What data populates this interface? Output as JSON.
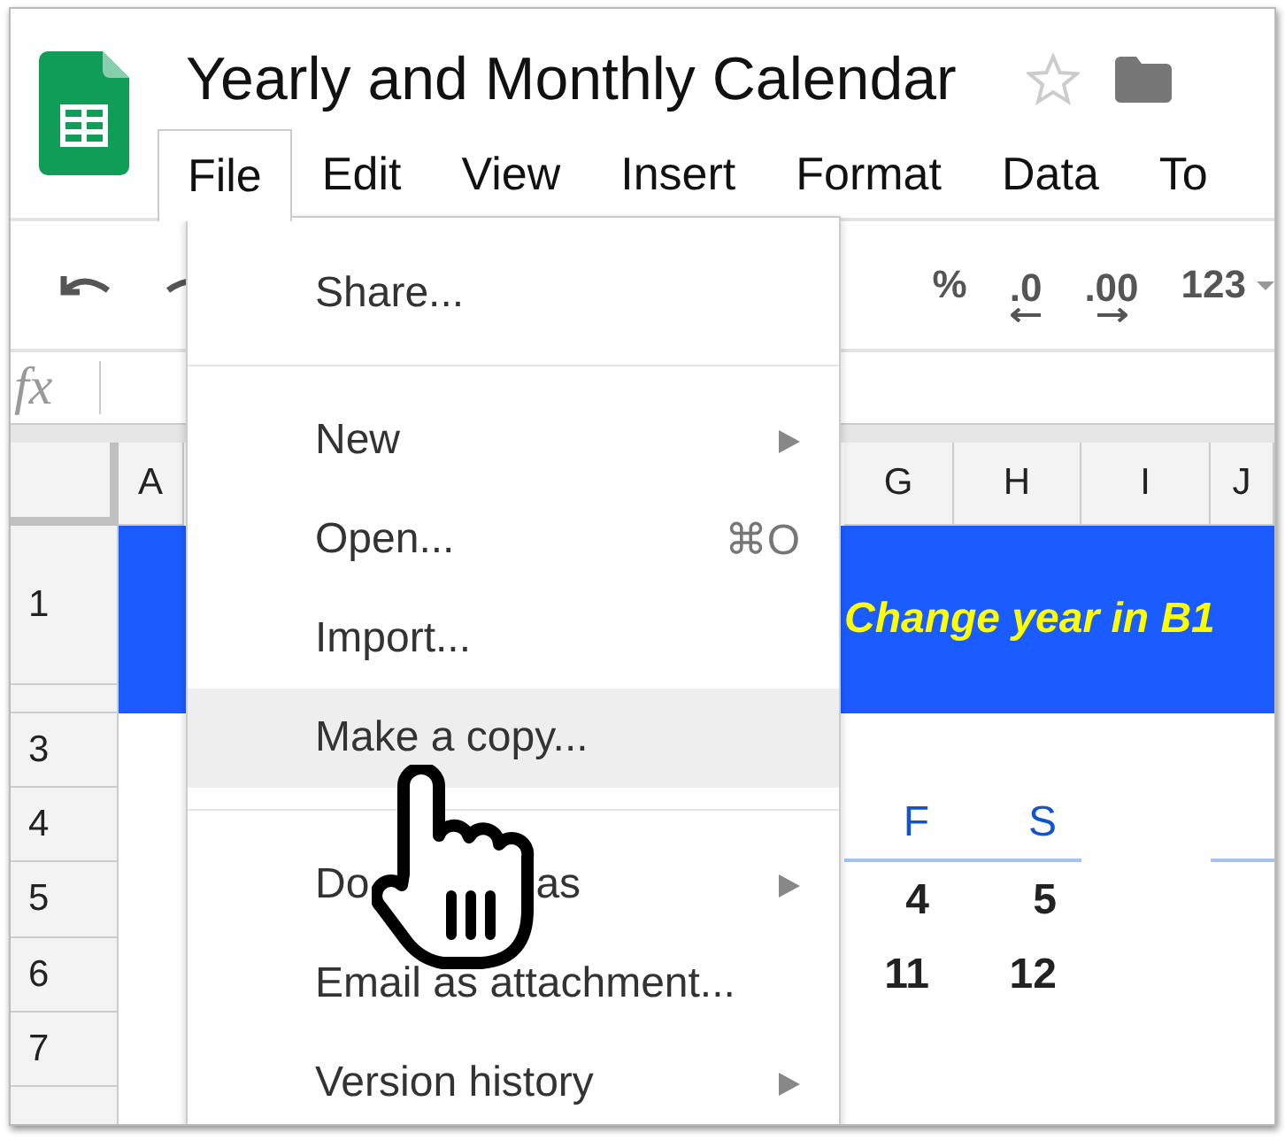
{
  "document": {
    "title": "Yearly and Monthly Calendar",
    "starred": false
  },
  "menu_bar": [
    {
      "label": "File",
      "selected": true
    },
    {
      "label": "Edit",
      "selected": false
    },
    {
      "label": "View",
      "selected": false
    },
    {
      "label": "Insert",
      "selected": false
    },
    {
      "label": "Format",
      "selected": false
    },
    {
      "label": "Data",
      "selected": false
    },
    {
      "label": "To",
      "selected": false
    }
  ],
  "toolbar": {
    "percent": "%",
    "decrease_decimals": ".0",
    "increase_decimals": ".00",
    "number_format": "123"
  },
  "formula_bar": {
    "label": "fx"
  },
  "sheet": {
    "columns": [
      "A",
      "G",
      "H",
      "I",
      "J"
    ],
    "row_numbers": [
      "1",
      "3",
      "4",
      "5",
      "6",
      "7"
    ],
    "banner": "Change year in B1",
    "calendar": {
      "headers": [
        "F",
        "S"
      ],
      "weeks": [
        [
          "4",
          "5"
        ],
        [
          "11",
          "12"
        ]
      ]
    }
  },
  "file_menu": [
    {
      "kind": "item",
      "label": "Share...",
      "selected": false
    },
    {
      "kind": "divider"
    },
    {
      "kind": "submenu",
      "label": "New",
      "selected": false
    },
    {
      "kind": "item",
      "label": "Open...",
      "shortcut": "⌘O",
      "selected": false
    },
    {
      "kind": "item",
      "label": "Import...",
      "selected": false
    },
    {
      "kind": "item",
      "label": "Make a copy...",
      "selected": true
    },
    {
      "kind": "divider"
    },
    {
      "kind": "submenu",
      "label": "Do",
      "label_end": "as",
      "selected": false
    },
    {
      "kind": "item",
      "label": "Email as attachment...",
      "selected": false
    },
    {
      "kind": "submenu",
      "label": "Version history",
      "selected": false
    }
  ]
}
